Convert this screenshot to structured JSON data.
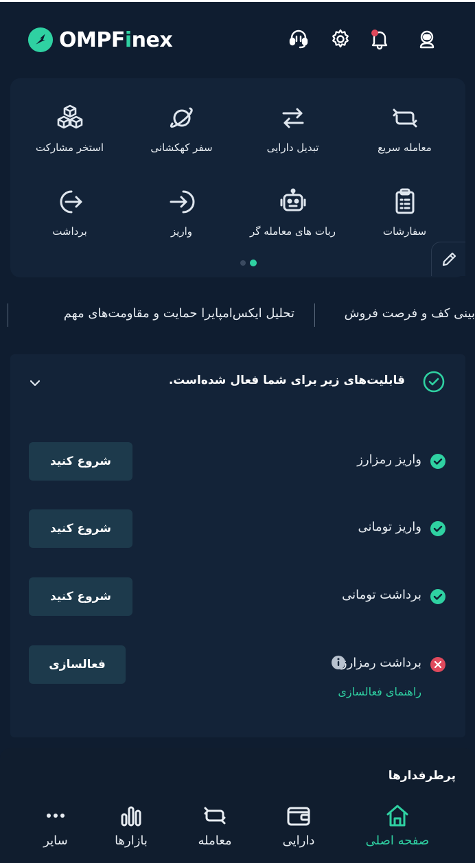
{
  "brand": {
    "name_prefix": "OMPF",
    "name_accent": "i",
    "name_suffix": "nex",
    "accent_color": "#2fd1a2"
  },
  "header": {
    "icons": [
      "support-headset-icon",
      "gear-icon",
      "bell-icon",
      "avatar-icon"
    ],
    "notification_dot_color": "#e0495c"
  },
  "quick_actions": {
    "items": [
      {
        "label": "معامله سریع",
        "icon": "quick-trade-icon"
      },
      {
        "label": "تبدیل دارایی",
        "icon": "convert-icon"
      },
      {
        "label": "سفر کهکشانی",
        "icon": "planet-icon"
      },
      {
        "label": "استخر مشارکت",
        "icon": "cubes-icon"
      },
      {
        "label": "سفارشات",
        "icon": "clipboard-icon"
      },
      {
        "label": "ربات های معامله گر",
        "icon": "robot-icon"
      },
      {
        "label": "واریز",
        "icon": "deposit-arrow-icon"
      },
      {
        "label": "برداشت",
        "icon": "withdraw-arrow-icon"
      }
    ],
    "page_count": 2,
    "active_page": 1
  },
  "news": {
    "items": [
      "بینی کف و فرصت فروش",
      "تحلیل ایکس‌امپایرا حمایت و مقاومت‌های مهم"
    ]
  },
  "features": {
    "title": "قابلیت‌های زیر برای شما فعال شده‌است.",
    "rows": [
      {
        "label": "واریز رمزارز",
        "status": "enabled",
        "button": "شروع کنید"
      },
      {
        "label": "واریز تومانی",
        "status": "enabled",
        "button": "شروع کنید"
      },
      {
        "label": "برداشت تومانی",
        "status": "enabled",
        "button": "شروع کنید"
      },
      {
        "label": "برداشت رمزارز",
        "status": "disabled",
        "button": "فعالسازی"
      }
    ],
    "guide_link": "راهنمای فعالسازی",
    "colors": {
      "enabled": "#2fd1a2",
      "disabled": "#e0495c"
    }
  },
  "popular": {
    "title": "پرطرفدارها"
  },
  "bottom_nav": {
    "items": [
      {
        "label": "صفحه اصلی",
        "icon": "home-icon",
        "active": true
      },
      {
        "label": "دارایی",
        "icon": "wallet-icon",
        "active": false
      },
      {
        "label": "معامله",
        "icon": "trade-icon",
        "active": false
      },
      {
        "label": "بازارها",
        "icon": "markets-icon",
        "active": false
      },
      {
        "label": "سایر",
        "icon": "more-icon",
        "active": false
      }
    ]
  }
}
